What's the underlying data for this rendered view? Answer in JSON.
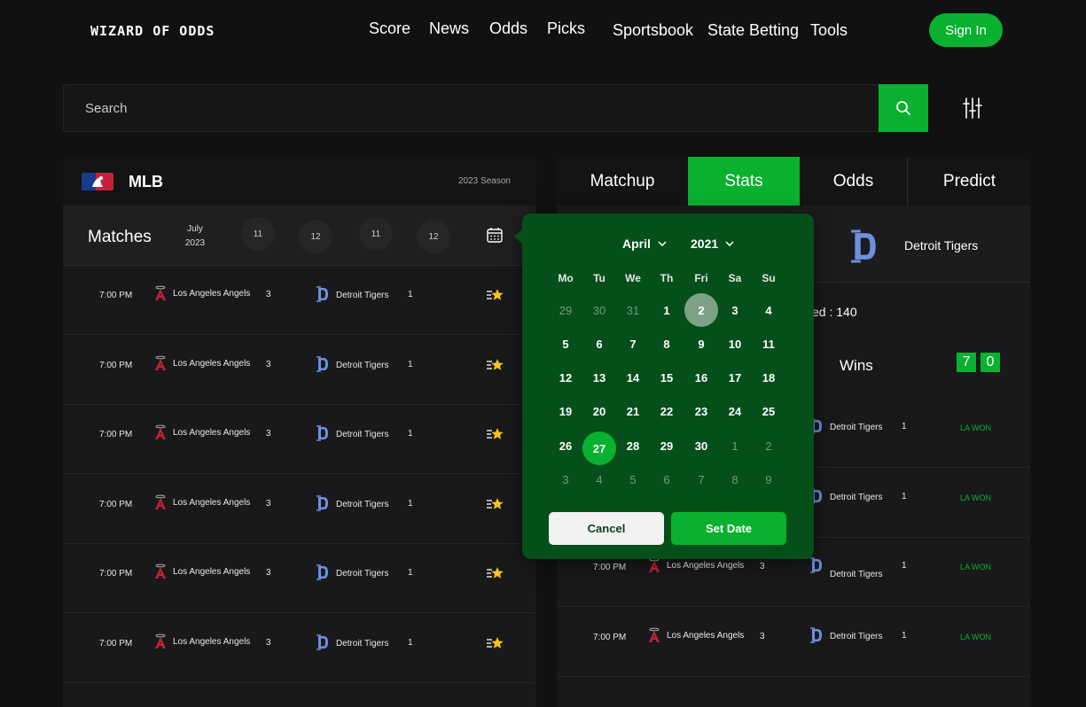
{
  "header": {
    "logo": "WIZARD OF ODDS",
    "nav": [
      "Score",
      "News",
      "Odds",
      "Picks",
      "Sportsbook",
      "State Betting",
      "Tools"
    ],
    "sign_in": "Sign In"
  },
  "search": {
    "placeholder": "Search"
  },
  "left_panel": {
    "league": "MLB",
    "season": "2023 Season",
    "matches_title": "Matches",
    "month": "July",
    "year": "2023",
    "dates": [
      "11",
      "12",
      "11",
      "12"
    ],
    "rows": [
      {
        "time": "7:00 PM",
        "home": "Los Angeles Angels",
        "home_score": "3",
        "away": "Detroit Tigers",
        "away_score": "1"
      },
      {
        "time": "7:00 PM",
        "home": "Los Angeles Angels",
        "home_score": "3",
        "away": "Detroit Tigers",
        "away_score": "1"
      },
      {
        "time": "7:00 PM",
        "home": "Los Angeles Angels",
        "home_score": "3",
        "away": "Detroit Tigers",
        "away_score": "1"
      },
      {
        "time": "7:00 PM",
        "home": "Los Angeles Angels",
        "home_score": "3",
        "away": "Detroit Tigers",
        "away_score": "1"
      },
      {
        "time": "7:00 PM",
        "home": "Los Angeles Angels",
        "home_score": "3",
        "away": "Detroit Tigers",
        "away_score": "1"
      },
      {
        "time": "7:00 PM",
        "home": "Los Angeles Angels",
        "home_score": "3",
        "away": "Detroit Tigers",
        "away_score": "1"
      }
    ]
  },
  "right_panel": {
    "tabs": [
      "Matchup",
      "Stats",
      "Odds",
      "Predict"
    ],
    "active_tab": "Stats",
    "team": "Detroit Tigers",
    "played_partial": "ed : 140",
    "wins_label": "Wins",
    "wins_digits": [
      "7",
      "0"
    ],
    "rows": [
      {
        "time": "",
        "home": "",
        "home_score": "",
        "away": "Detroit Tigers",
        "away_score": "1",
        "result": "LA WON"
      },
      {
        "time": "",
        "home": "",
        "home_score": "",
        "away": "Detroit Tigers",
        "away_score": "1",
        "result": "LA WON"
      },
      {
        "time": "7:00 PM",
        "home": "Los Angeles Angels",
        "home_score": "3",
        "away": "Detroit Tigers",
        "away_score": "1",
        "result": "LA WON"
      },
      {
        "time": "7:00 PM",
        "home": "Los Angeles Angels",
        "home_score": "3",
        "away": "Detroit Tigers",
        "away_score": "1",
        "result": "LA WON"
      }
    ]
  },
  "calendar": {
    "month": "April",
    "year": "2021",
    "weekdays": [
      "Mo",
      "Tu",
      "We",
      "Th",
      "Fri",
      "Sa",
      "Su"
    ],
    "weeks": [
      [
        "29",
        "30",
        "31",
        "1",
        "2",
        "3",
        "4"
      ],
      [
        "5",
        "6",
        "7",
        "8",
        "9",
        "10",
        "11"
      ],
      [
        "12",
        "13",
        "14",
        "15",
        "16",
        "17",
        "18"
      ],
      [
        "19",
        "20",
        "21",
        "22",
        "23",
        "24",
        "25"
      ],
      [
        "26",
        "27",
        "28",
        "29",
        "30",
        "1",
        "2"
      ],
      [
        "3",
        "4",
        "5",
        "6",
        "7",
        "8",
        "9"
      ]
    ],
    "selected_day": "27",
    "hover_day": "2",
    "cancel": "Cancel",
    "set_date": "Set Date"
  },
  "colors": {
    "accent": "#09b12e",
    "popup_bg": "#054f1b",
    "tigers_blue": "#6f8fe0",
    "angels_red": "#c4213a"
  },
  "icons": [
    "search-icon",
    "filter-icon",
    "calendar-icon",
    "chevron-down-icon",
    "angels-logo-icon",
    "tigers-logo-icon",
    "star-icon",
    "mlb-logo-icon"
  ]
}
